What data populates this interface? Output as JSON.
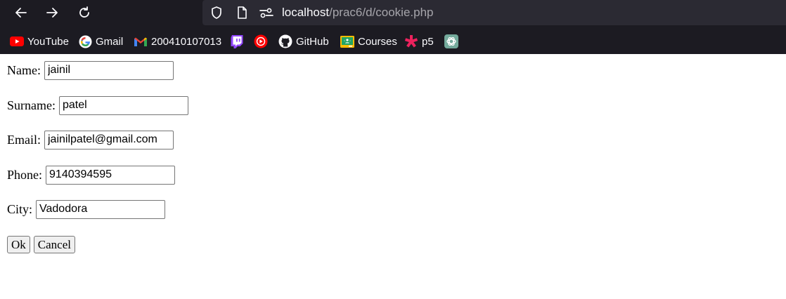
{
  "browser": {
    "url_host": "localhost",
    "url_path": "/prac6/d/cookie.php",
    "bookmarks": [
      {
        "label": "YouTube",
        "icon": "youtube-icon"
      },
      {
        "label": "Gmail",
        "icon": "google-icon"
      },
      {
        "label": "200410107013",
        "icon": "gmail-icon"
      },
      {
        "label": "",
        "icon": "twitch-icon"
      },
      {
        "label": "",
        "icon": "youtube-music-icon"
      },
      {
        "label": "GitHub",
        "icon": "github-icon"
      },
      {
        "label": "Courses",
        "icon": "google-classroom-icon"
      },
      {
        "label": "p5",
        "icon": "p5-icon"
      },
      {
        "label": "",
        "icon": "chatgpt-icon"
      }
    ]
  },
  "form": {
    "name": {
      "label": "Name:",
      "value": "jainil"
    },
    "surname": {
      "label": "Surname:",
      "value": "patel"
    },
    "email": {
      "label": "Email:",
      "value": "jainilpatel@gmail.com"
    },
    "phone": {
      "label": "Phone:",
      "value": "9140394595"
    },
    "city": {
      "label": "City:",
      "value": "Vadodora"
    },
    "ok_label": "Ok",
    "cancel_label": "Cancel"
  },
  "colors": {
    "chrome_bg": "#1c1b22",
    "url_bar_bg": "#2b2a33",
    "youtube_red": "#ff0000",
    "twitch_purple": "#9146ff",
    "p5_pink": "#ed225d"
  }
}
